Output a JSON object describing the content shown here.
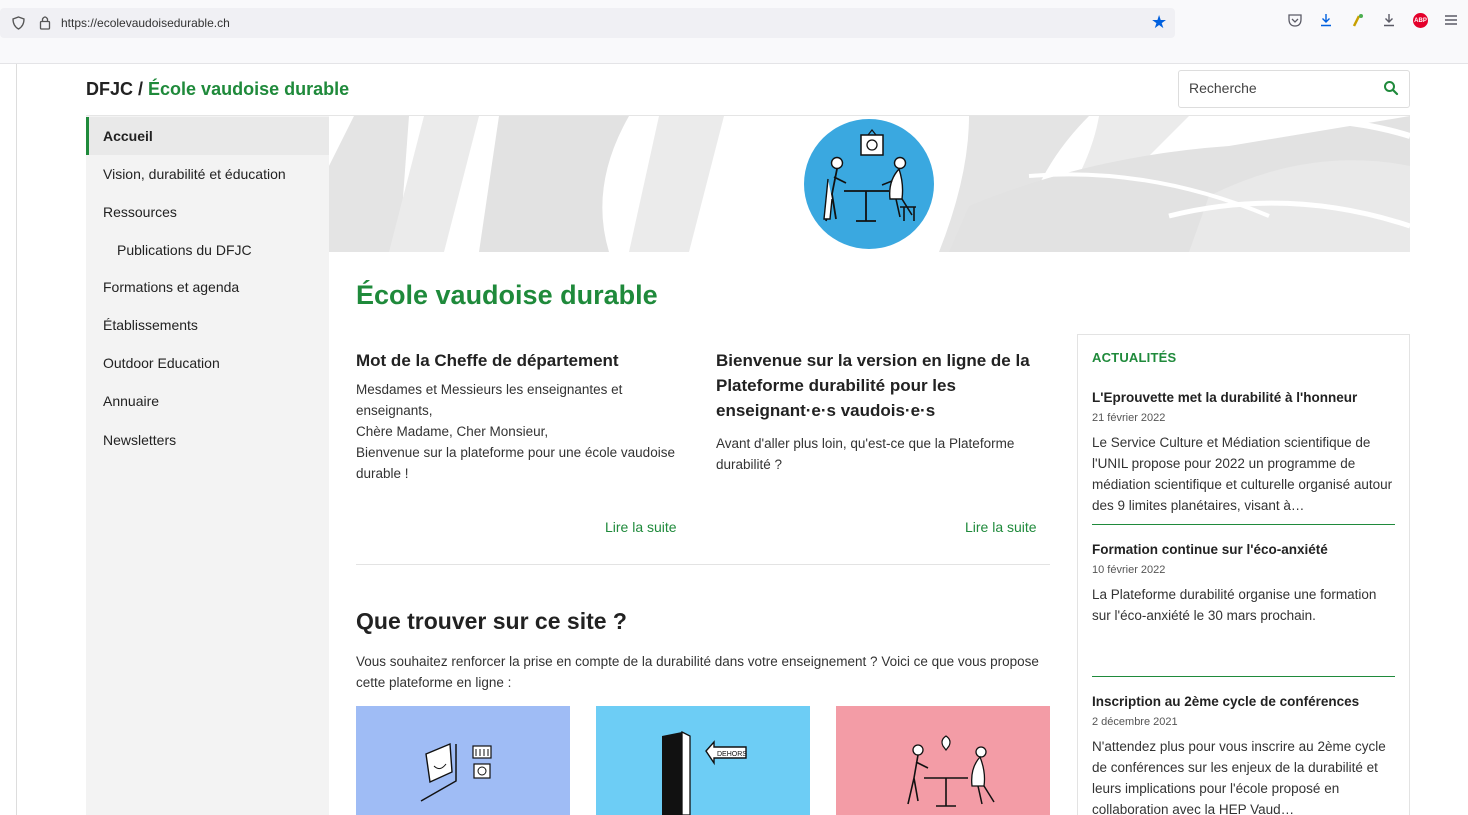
{
  "browser": {
    "url": "https://ecolevaudoisedurable.ch",
    "toolbar_icons": [
      "pocket-icon",
      "download-icon",
      "extension-icon",
      "download-icon",
      "adblock-icon",
      "menu-icon"
    ],
    "abp_label": "ABP"
  },
  "header": {
    "org": "DFJC /",
    "site_name": "École vaudoise durable",
    "search_placeholder": "Recherche"
  },
  "sidebar": {
    "items": [
      {
        "label": "Accueil"
      },
      {
        "label": "Vision, durabilité et éducation"
      },
      {
        "label": "Ressources"
      },
      {
        "label": "Publications du DFJC"
      },
      {
        "label": "Formations et agenda"
      },
      {
        "label": "Établissements"
      },
      {
        "label": "Outdoor Education"
      },
      {
        "label": "Annuaire"
      },
      {
        "label": "Newsletters"
      }
    ]
  },
  "main": {
    "title": "École vaudoise durable",
    "col1": {
      "heading": "Mot de la Cheffe de département",
      "line1": "Mesdames et Messieurs les enseignantes et enseignants,",
      "line2": "Chère Madame, Cher Monsieur,",
      "line3": "Bienvenue sur la plateforme pour une école vaudoise durable !",
      "read_more": "Lire la suite"
    },
    "col2": {
      "heading": "Bienvenue sur la version en ligne de la Plateforme durabilité pour les enseignant·e·s vaudois·e·s",
      "text": "Avant d'aller plus loin, qu'est-ce que la Plateforme durabilité ?",
      "read_more": "Lire la suite"
    },
    "section_title": "Que trouver sur ce site ?",
    "section_intro": "Vous souhaitez renforcer la prise en compte de la durabilité dans votre enseignement ? Voici ce que vous propose cette plateforme en ligne :",
    "card_door_sign": "DEHORS",
    "cards_colors": [
      "#9fbcf5",
      "#6dcdf5",
      "#f39ca6"
    ]
  },
  "news": {
    "heading": "ACTUALITÉS",
    "items": [
      {
        "title": "L'Eprouvette met la durabilité à l'honneur",
        "date": "21 février 2022",
        "text": "Le Service Culture et Médiation scientifique de l'UNIL propose pour 2022 un programme de médiation scientifique et culturelle organisé autour des 9 limites planétaires, visant à…"
      },
      {
        "title": "Formation continue sur l'éco-anxiété",
        "date": "10 février 2022",
        "text": "La Plateforme durabilité organise une formation sur l'éco-anxiété le 30 mars prochain."
      },
      {
        "title": "Inscription au 2ème cycle de conférences",
        "date": "2 décembre 2021",
        "text": "N'attendez plus pour vous inscrire au 2ème cycle de conférences sur les enjeux de la durabilité et leurs implications pour l'école proposé en collaboration avec la HEP Vaud…"
      }
    ]
  },
  "colors": {
    "accent": "#1f8a3b",
    "banner_circle": "#3aa8e0"
  }
}
